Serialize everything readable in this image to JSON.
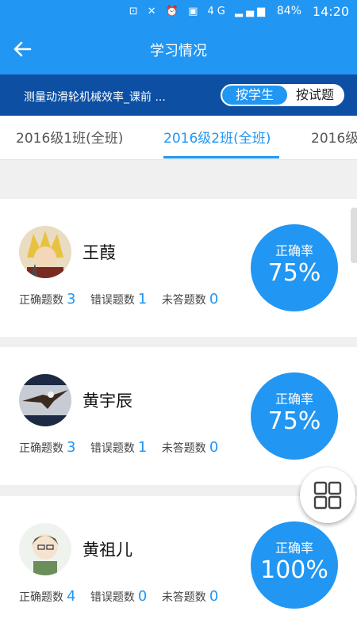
{
  "status_bar": {
    "battery": "84%",
    "time": "14:20"
  },
  "app_bar": {
    "title": "学习情况"
  },
  "sub_bar": {
    "exam_name": "测量动滑轮机械效率_课前 ...",
    "toggle": {
      "by_student": "按学生",
      "by_question": "按试题"
    }
  },
  "tabs": [
    "2016级1班(全班)",
    "2016级2班(全班)",
    "2016级"
  ],
  "stat_labels": {
    "correct": "正确题数",
    "wrong": "错误题数",
    "unanswered": "未答题数"
  },
  "rate_label": "正确率",
  "students": [
    {
      "name": "王葭",
      "correct": "3",
      "wrong": "1",
      "unanswered": "0",
      "rate": "75%"
    },
    {
      "name": "黄宇辰",
      "correct": "3",
      "wrong": "1",
      "unanswered": "0",
      "rate": "75%"
    },
    {
      "name": "黄祖儿",
      "correct": "4",
      "wrong": "0",
      "unanswered": "0",
      "rate": "100%"
    }
  ],
  "colors": {
    "primary": "#2196f3",
    "dark_bar": "#0d4fa3"
  },
  "icons": [
    "back-arrow-icon",
    "grid-menu-icon"
  ]
}
